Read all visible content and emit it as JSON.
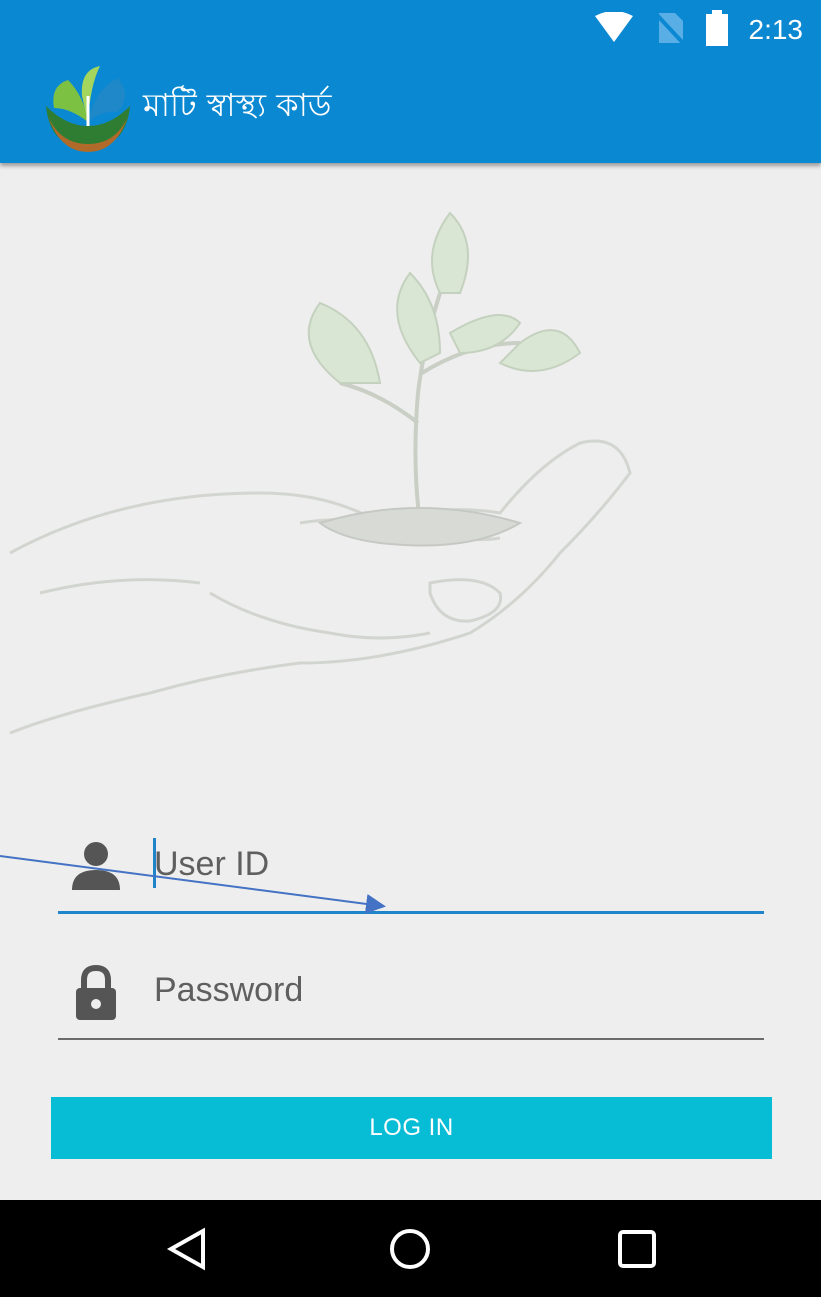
{
  "status_bar": {
    "time": "2:13",
    "icons": [
      "wifi-icon",
      "no-sim-icon",
      "battery-icon"
    ]
  },
  "app_bar": {
    "logo": "app-logo-sprout",
    "title": "মাটি স্বাস্থ্য কার্ড"
  },
  "login": {
    "user_id_placeholder": "User ID",
    "password_placeholder": "Password",
    "login_label": "LOG IN"
  },
  "nav": {
    "back": "back-icon",
    "home": "home-icon",
    "recent": "recent-apps-icon"
  },
  "colors": {
    "app_bar": "#0a88d2",
    "accent": "#1f84c9",
    "button": "#07bcd5",
    "background": "#eeeeee",
    "nav_bar": "#000000"
  }
}
